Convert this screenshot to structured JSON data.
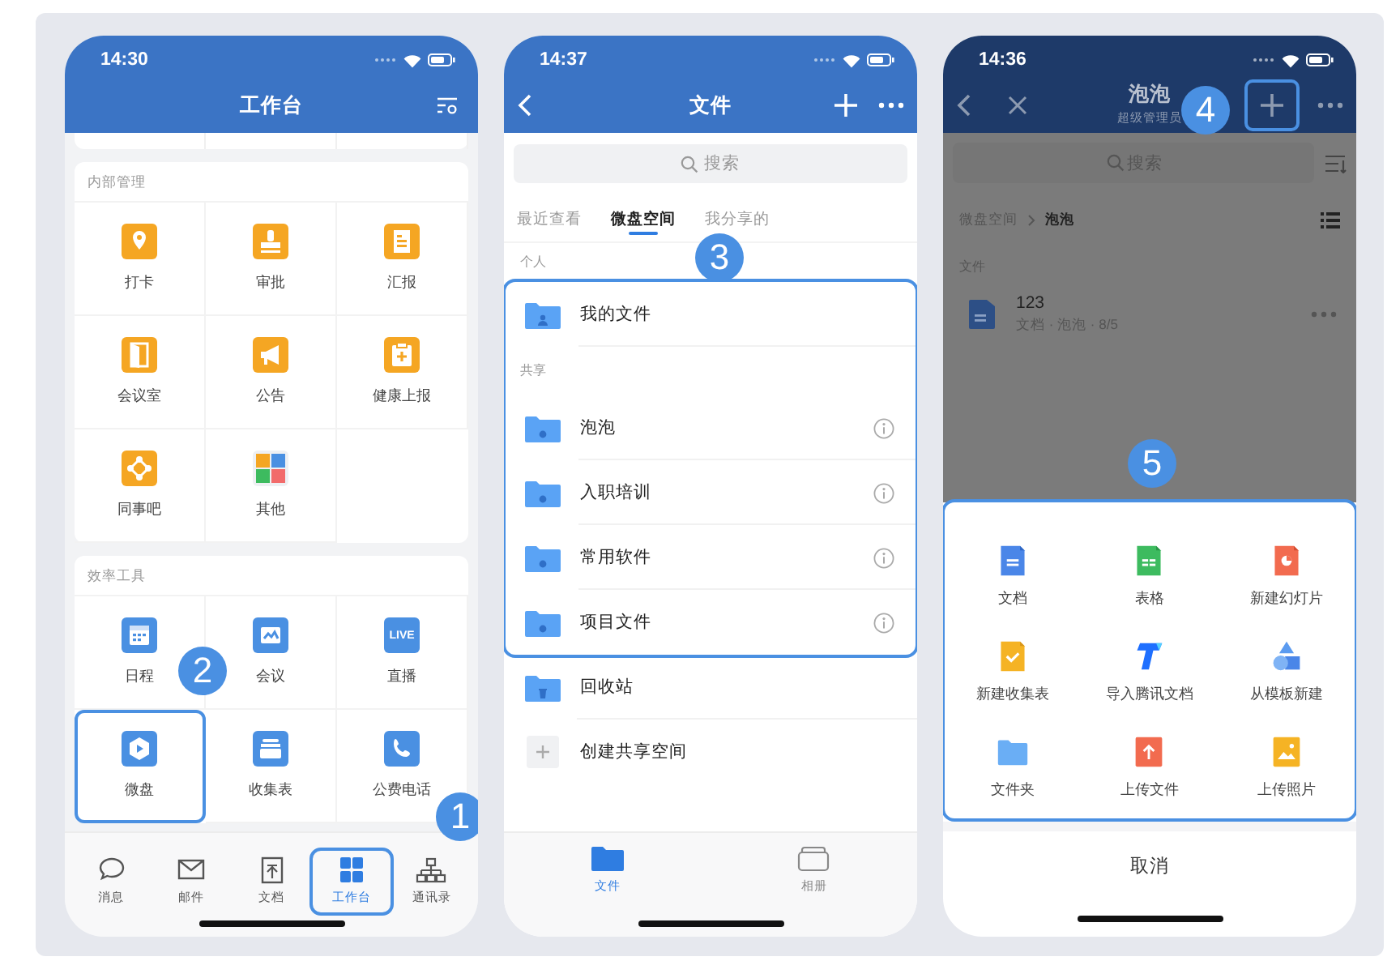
{
  "workbench_screen": {
    "status_time": "14:30",
    "title": "工作台",
    "sections": [
      {
        "title": "内部管理",
        "apps": [
          {
            "label": "打卡",
            "highlighted": false
          },
          {
            "label": "审批",
            "highlighted": false
          },
          {
            "label": "汇报",
            "highlighted": false
          },
          {
            "label": "会议室",
            "highlighted": false
          },
          {
            "label": "公告",
            "highlighted": false
          },
          {
            "label": "健康上报",
            "highlighted": false
          },
          {
            "label": "同事吧",
            "highlighted": false
          },
          {
            "label": "其他",
            "highlighted": false
          }
        ]
      },
      {
        "title": "效率工具",
        "apps": [
          {
            "label": "日程",
            "highlighted": false
          },
          {
            "label": "会议",
            "highlighted": false
          },
          {
            "label": "直播",
            "icon_text": "LIVE",
            "highlighted": false
          },
          {
            "label": "微盘",
            "highlighted": true
          },
          {
            "label": "收集表",
            "highlighted": false
          },
          {
            "label": "公费电话",
            "highlighted": false
          }
        ]
      }
    ],
    "tabs": [
      {
        "label": "消息",
        "selected": false,
        "highlighted": false
      },
      {
        "label": "邮件",
        "selected": false,
        "highlighted": false
      },
      {
        "label": "文档",
        "selected": false,
        "highlighted": false
      },
      {
        "label": "工作台",
        "selected": true,
        "highlighted": true
      },
      {
        "label": "通讯录",
        "selected": false,
        "highlighted": false
      }
    ],
    "callouts": [
      "2",
      "1"
    ]
  },
  "files_screen": {
    "status_time": "14:37",
    "title": "文件",
    "search": {
      "placeholder": "搜索"
    },
    "tabs": [
      {
        "label": "最近查看",
        "selected": false
      },
      {
        "label": "微盘空间",
        "selected": true
      },
      {
        "label": "我分享的",
        "selected": false
      }
    ],
    "sections_highlighted": true,
    "sections": [
      {
        "title": "个人",
        "items": [
          {
            "name": "我的文件",
            "kind": "personal",
            "info": false
          }
        ]
      },
      {
        "title": "共享",
        "items": [
          {
            "name": "泡泡",
            "kind": "shared",
            "info": true
          },
          {
            "name": "入职培训",
            "kind": "shared",
            "info": true
          },
          {
            "name": "常用软件",
            "kind": "shared",
            "info": true
          },
          {
            "name": "项目文件",
            "kind": "shared",
            "info": true
          }
        ]
      }
    ],
    "extra_items": [
      {
        "name": "回收站",
        "kind": "trash",
        "info": false
      },
      {
        "name": "创建共享空间",
        "kind": "add",
        "info": false
      }
    ],
    "bottom_tabs": [
      {
        "label": "文件",
        "selected": true
      },
      {
        "label": "相册",
        "selected": false
      }
    ],
    "callouts": [
      "3"
    ]
  },
  "folder_screen": {
    "status_time": "14:36",
    "title": "泡泡",
    "subtitle": "超级管理员",
    "add_button": {
      "highlighted": true
    },
    "search": {
      "placeholder": "搜索"
    },
    "breadcrumb": [
      "微盘空间",
      "泡泡"
    ],
    "section": "文件",
    "files": [
      {
        "name": "123",
        "meta": "文档 · 泡泡 · 8/5"
      }
    ],
    "sheet": {
      "highlighted": true,
      "options": [
        {
          "label": "文档"
        },
        {
          "label": "表格"
        },
        {
          "label": "新建幻灯片"
        },
        {
          "label": "新建收集表"
        },
        {
          "label": "导入腾讯文档"
        },
        {
          "label": "从模板新建"
        },
        {
          "label": "文件夹"
        },
        {
          "label": "上传文件"
        },
        {
          "label": "上传照片"
        }
      ],
      "cancel": "取消"
    },
    "callouts": [
      "4",
      "5"
    ]
  }
}
